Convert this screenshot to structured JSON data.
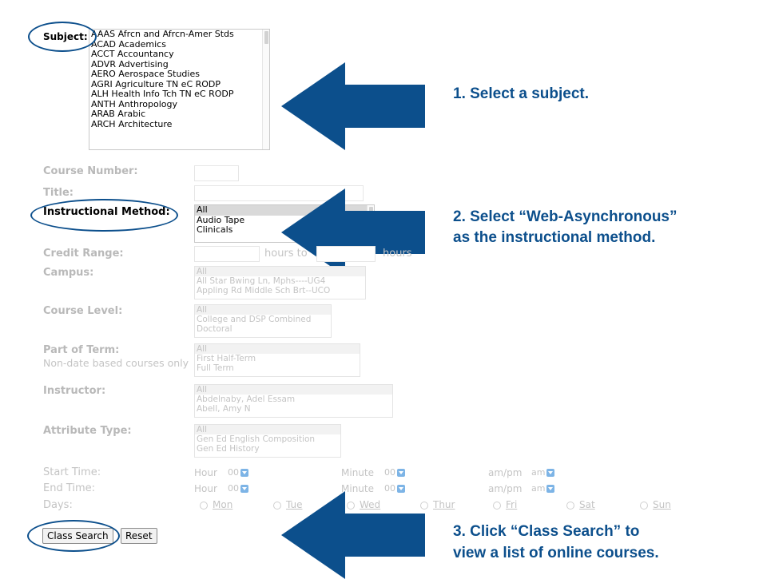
{
  "form": {
    "subject_label": "Subject:",
    "subjects": [
      "AAAS Afrcn and Afrcn-Amer Stds",
      "ACAD Academics",
      "ACCT Accountancy",
      "ADVR Advertising",
      "AERO Aerospace Studies",
      "AGRI Agriculture TN eC RODP",
      "ALH Health Info Tch TN eC RODP",
      "ANTH Anthropology",
      "ARAB Arabic",
      "ARCH Architecture"
    ],
    "course_number_label": "Course Number:",
    "title_label": "Title:",
    "method_label": "Instructional Method:",
    "methods": [
      "All",
      "Audio Tape",
      "Clinicals"
    ],
    "credit_label": "Credit Range:",
    "credit_hours_to": "hours to",
    "credit_hours": "hours",
    "campus_label": "Campus:",
    "campus": [
      "All",
      "All Star Bwing Ln, Mphs----UG4",
      "Appling Rd Middle Sch Brt--UCO"
    ],
    "level_label": "Course Level:",
    "levels": [
      "All",
      "College and DSP Combined",
      "Doctoral"
    ],
    "term_label": "Part of Term:",
    "term_sub": "Non-date based courses only",
    "terms": [
      "All",
      "First Half-Term",
      "Full Term"
    ],
    "instructor_label": "Instructor:",
    "instructors": [
      "All",
      "Abdelnaby, Adel Essam",
      "Abell, Amy N"
    ],
    "attribute_label": "Attribute Type:",
    "attributes": [
      "All",
      "Gen Ed English Composition",
      "Gen Ed History"
    ],
    "start_label": "Start Time:",
    "end_label": "End Time:",
    "hour_label": "Hour",
    "minute_label": "Minute",
    "ampm_label": "am/pm",
    "hour_value": "00",
    "minute_value": "00",
    "ampm_value": "am",
    "days_label": "Days:",
    "days": [
      "Mon",
      "Tue",
      "Wed",
      "Thur",
      "Fri",
      "Sat",
      "Sun"
    ],
    "search_button": "Class Search",
    "reset_button": "Reset"
  },
  "callouts": {
    "step1": "1. Select a subject.",
    "step2_line1": "2. Select “Web-Asynchronous”",
    "step2_line2": "as the instructional method.",
    "step3_line1": "3. Click “Class Search” to",
    "step3_line2": "view a list of online courses."
  },
  "colors": {
    "accent": "#0c4f8c",
    "disabled_text": "#c4c4c4"
  }
}
